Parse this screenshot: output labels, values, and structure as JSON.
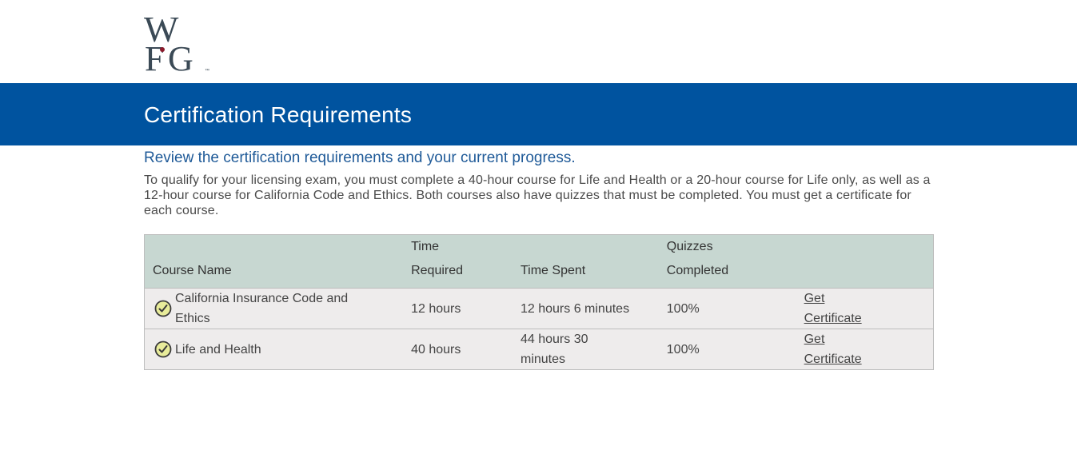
{
  "logo": {
    "alt": "WFG",
    "tm": "™",
    "primary_color": "#3b4a56",
    "dot_color": "#8b1a2b"
  },
  "header": {
    "title": "Certification Requirements",
    "background": "#00539f"
  },
  "main": {
    "subtitle": "Review the certification requirements and your current progress.",
    "intro": "To qualify for your licensing exam, you must complete a 40-hour course for Life and Health or a 20-hour course for Life only, as well as a 12-hour course for California Code and Ethics. Both courses also have quizzes that must be completed. You must get a certificate for each course."
  },
  "table": {
    "headers": {
      "course_name": "Course Name",
      "time_required_line1": "Time",
      "time_required_line2": "Required",
      "time_spent": "Time Spent",
      "quizzes_line1": "Quizzes",
      "quizzes_line2": "Completed"
    },
    "rows": [
      {
        "status_icon": "check-circle-icon",
        "course_name": "California Insurance Code and Ethics",
        "time_required": "12 hours",
        "time_spent": "12 hours 6 minutes",
        "quizzes_completed": "100%",
        "action": "Get Certificate"
      },
      {
        "status_icon": "check-circle-icon",
        "course_name": "Life and Health",
        "time_required": "40 hours",
        "time_spent": "44 hours 30 minutes",
        "quizzes_completed": "100%",
        "action": "Get Certificate"
      }
    ]
  },
  "colors": {
    "header_row": "#c7d7d1",
    "body_row": "#eeecec",
    "subtitle": "#1f5a98",
    "check_fill": "#e8ec9a"
  }
}
